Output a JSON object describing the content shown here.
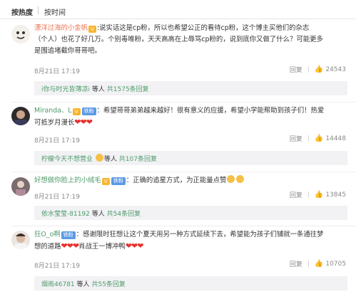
{
  "sort": {
    "hot": "按热度",
    "time": "按时间"
  },
  "comments": [
    {
      "username": "漂洋过海的小金帆",
      "badge": "V",
      "line1": ":说实话这是cp粉，所以也希望公正的看待cp粉，这个博主买他们的杂志",
      "line2": "（个人）也花了好几万。个别毒唯粉，天天高高在上辱骂cp粉的，说到底你又做了什么？可能更多",
      "line3": "是围追堵截你哥哥吧。",
      "date": "8月21日 17:19",
      "reply": "回复",
      "likes": "24543",
      "sub_user": "i你与时光皆薄凉i",
      "sub_text": "等人",
      "sub_total": "共1575条回复"
    },
    {
      "username": "Miranda、L",
      "badge": "V",
      "fan_badge": "铁粉",
      "line1": "：希望哥哥弟弟越来越好！很有意义的应援，希望小学能帮助到孩子们！热爱",
      "line2": "可抵岁月漫长",
      "date": "8月21日 17:19",
      "reply": "回复",
      "likes": "14448",
      "sub_user": "柠檬今天不想营业",
      "sub_text": "等人",
      "sub_total": "共107条回复"
    },
    {
      "username": "好想做你脸上的小绒毛",
      "badge": "V",
      "fan_badge": "铁粉",
      "line1": "：正确的追星方式，为正能量点赞",
      "date": "8月21日 17:19",
      "reply": "回复",
      "likes": "13845",
      "sub_user": "依水莹莹-81192",
      "sub_text": "等人",
      "sub_total": "共54条回复"
    },
    {
      "username": "狂O_o啊",
      "fan_badge": "铁粉",
      "line1": "：感谢限时狂想让这个夏天用另一种方式延续下去，希望能为孩子们铺就一条通往梦",
      "line2a": "想的道路",
      "line2b": "肖战王一博冲鸭",
      "date": "8月21日 17:19",
      "reply": "回复",
      "likes": "10705",
      "sub_user": "烟雨46781",
      "sub_text": "等人",
      "sub_total": "共55条回复"
    }
  ],
  "colors": {
    "accent_name": "#eb7350",
    "green_link": "#4f9b6a",
    "heart": "#e8302d"
  }
}
